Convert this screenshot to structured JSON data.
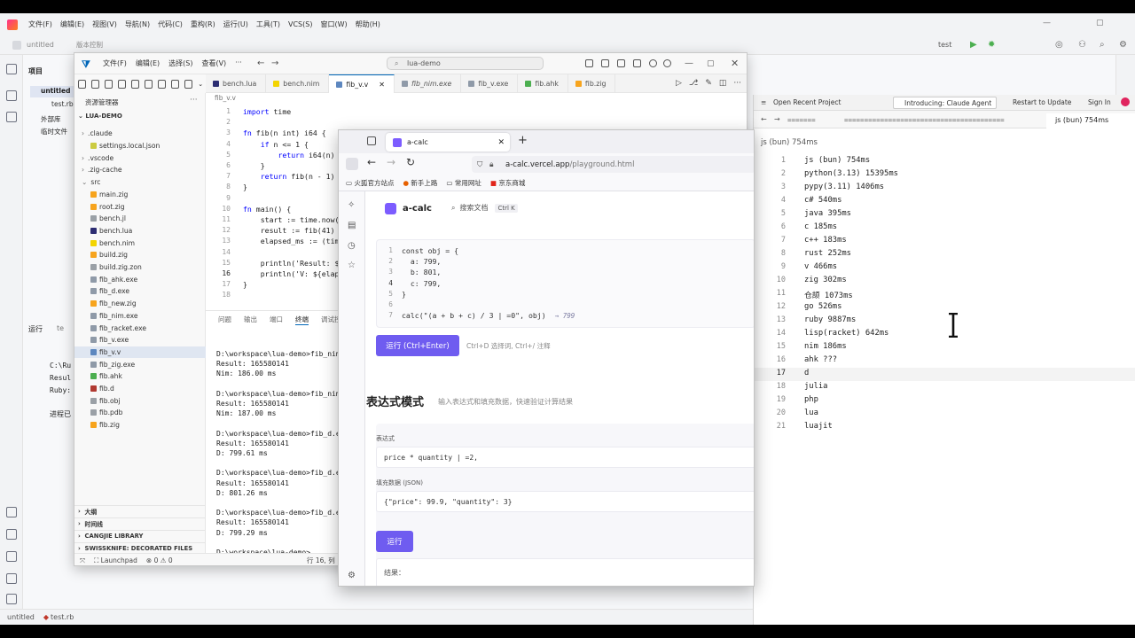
{
  "ide": {
    "menu": [
      "文件(F)",
      "编辑(E)",
      "视图(V)",
      "导航(N)",
      "代码(C)",
      "重构(R)",
      "运行(U)",
      "工具(T)",
      "VCS(S)",
      "窗口(W)",
      "帮助(H)"
    ],
    "project_name": "untitled",
    "vcs_label": "版本控制",
    "run_config": "test",
    "project_label": "项目",
    "tree": [
      "untitled",
      "test.rb",
      "外部库",
      "临时文件"
    ],
    "run_label": "运行",
    "run_tab": "te",
    "run_lines": [
      "C:\\Ru",
      "Resul",
      "Ruby:",
      "进程已"
    ],
    "status": [
      "untitled",
      "test.rb"
    ]
  },
  "vscode": {
    "menu": [
      "文件(F)",
      "编辑(E)",
      "选择(S)",
      "查看(V)",
      "···"
    ],
    "search": "lua-demo",
    "explorer_title": "资源管理器",
    "root": "LUA-DEMO",
    "files": [
      {
        "name": ".claude",
        "kind": "folder"
      },
      {
        "name": "settings.local.json",
        "kind": "json"
      },
      {
        "name": ".vscode",
        "kind": "folder"
      },
      {
        "name": ".zig-cache",
        "kind": "folder"
      },
      {
        "name": "src",
        "kind": "folder"
      },
      {
        "name": "main.zig",
        "kind": "zig"
      },
      {
        "name": "root.zig",
        "kind": "zig"
      },
      {
        "name": "bench.jl",
        "kind": "file"
      },
      {
        "name": "bench.lua",
        "kind": "lua"
      },
      {
        "name": "bench.nim",
        "kind": "nim"
      },
      {
        "name": "build.zig",
        "kind": "zig"
      },
      {
        "name": "build.zig.zon",
        "kind": "file"
      },
      {
        "name": "fib_ahk.exe",
        "kind": "exe"
      },
      {
        "name": "fib_d.exe",
        "kind": "exe"
      },
      {
        "name": "fib_new.zig",
        "kind": "zig"
      },
      {
        "name": "fib_nim.exe",
        "kind": "exe"
      },
      {
        "name": "fib_racket.exe",
        "kind": "exe"
      },
      {
        "name": "fib_v.exe",
        "kind": "exe"
      },
      {
        "name": "fib_v.v",
        "kind": "v"
      },
      {
        "name": "fib_zig.exe",
        "kind": "exe"
      },
      {
        "name": "fib.ahk",
        "kind": "ahk"
      },
      {
        "name": "fib.d",
        "kind": "d"
      },
      {
        "name": "fib.obj",
        "kind": "file"
      },
      {
        "name": "fib.pdb",
        "kind": "file"
      },
      {
        "name": "fib.zig",
        "kind": "zig"
      }
    ],
    "sections": [
      "大纲",
      "时间线",
      "CANGJIE LIBRARY",
      "SWISSKNIFE: DECORATED FILES"
    ],
    "tabs": [
      "bench.lua",
      "bench.nim",
      "fib_v.v",
      "fib_nim.exe",
      "fib_v.exe",
      "fib.ahk",
      "fib.zig"
    ],
    "breadcrumb": "fib_v.v",
    "code_lines": [
      "import time",
      "",
      "fn fib(n int) i64 {",
      "    if n <= 1 {",
      "        return i64(n)",
      "    }",
      "    return fib(n - 1)",
      "}",
      "",
      "fn main() {",
      "    start := time.now(",
      "    result := fib(41)",
      "    elapsed_ms := (tim",
      "",
      "    println('Result: $",
      "    println('V: ${elap",
      "}",
      ""
    ],
    "panel_tabs": [
      "问题",
      "输出",
      "端口",
      "终端",
      "调试控"
    ],
    "terminal": [
      "D:\\workspace\\lua-demo>fib_nim.",
      "Result: 165580141",
      "Nim: 186.00 ms",
      "",
      "D:\\workspace\\lua-demo>fib_nim.",
      "Result: 165580141",
      "Nim: 187.00 ms",
      "",
      "D:\\workspace\\lua-demo>fib_d.ex",
      "Result: 165580141",
      "D: 799.61 ms",
      "",
      "D:\\workspace\\lua-demo>fib_d.ex",
      "Result: 165580141",
      "D: 801.26 ms",
      "",
      "D:\\workspace\\lua-demo>fib_d.ex",
      "Result: 165580141",
      "D: 799.29 ms",
      "",
      "D:\\workspace\\lua-demo>"
    ],
    "status": [
      "Launchpad",
      "0",
      "0",
      "行 16, 列"
    ]
  },
  "firefox": {
    "tab_title": "a-calc",
    "url_host": "a-calc.vercel.app",
    "url_path": "/playground.html",
    "bookmarks": [
      "火狐官方站点",
      "新手上路",
      "常用网址",
      "京东商城"
    ],
    "app_title": "a-calc",
    "doc_search": "搜索文档",
    "doc_search_kbd": "Ctrl K",
    "code": [
      {
        "n": "1",
        "t": "const obj = {"
      },
      {
        "n": "2",
        "t": "  a: 799,"
      },
      {
        "n": "3",
        "t": "  b: 801,"
      },
      {
        "n": "4",
        "t": "  c: 799,"
      },
      {
        "n": "5",
        "t": "}"
      },
      {
        "n": "6",
        "t": ""
      },
      {
        "n": "7",
        "t": "calc(\"(a + b + c) / 3 | =0\", obj)"
      }
    ],
    "code_result": "→ 799",
    "run_label": "运行 (Ctrl+Enter)",
    "run_hint": "Ctrl+D 选择词, Ctrl+/ 注释",
    "section_title": "表达式模式",
    "section_desc": "输入表达式和填充数据，快速验证计算结果",
    "expr_label": "表达式",
    "expr_value": "price * quantity | =2,",
    "data_label": "填充数据 (JSON)",
    "data_value": "{\"price\": 99.9, \"quantity\": 3}",
    "run2_label": "运行",
    "result_label": "结果："
  },
  "rpanel": {
    "title_left": "Open Recent Project",
    "notif": "Introducing: Claude Agent",
    "restart": "Restart to Update",
    "signin": "Sign In",
    "tabs": [
      "=======",
      "========================================",
      "js (bun) 754ms"
    ],
    "breadcrumb": "js (bun) 754ms",
    "lines": [
      "js (bun) 754ms",
      "python(3.13) 15395ms",
      "pypy(3.11) 1406ms",
      "c# 540ms",
      "java 395ms",
      "c 185ms",
      "c++ 183ms",
      "rust 252ms",
      "v 466ms",
      "zig 302ms",
      "仓颉 1073ms",
      "go 526ms",
      "ruby 9887ms",
      "lisp(racket) 642ms",
      "nim 186ms",
      "ahk ???",
      "d",
      "julia",
      "php",
      "lua",
      "luajit"
    ]
  }
}
